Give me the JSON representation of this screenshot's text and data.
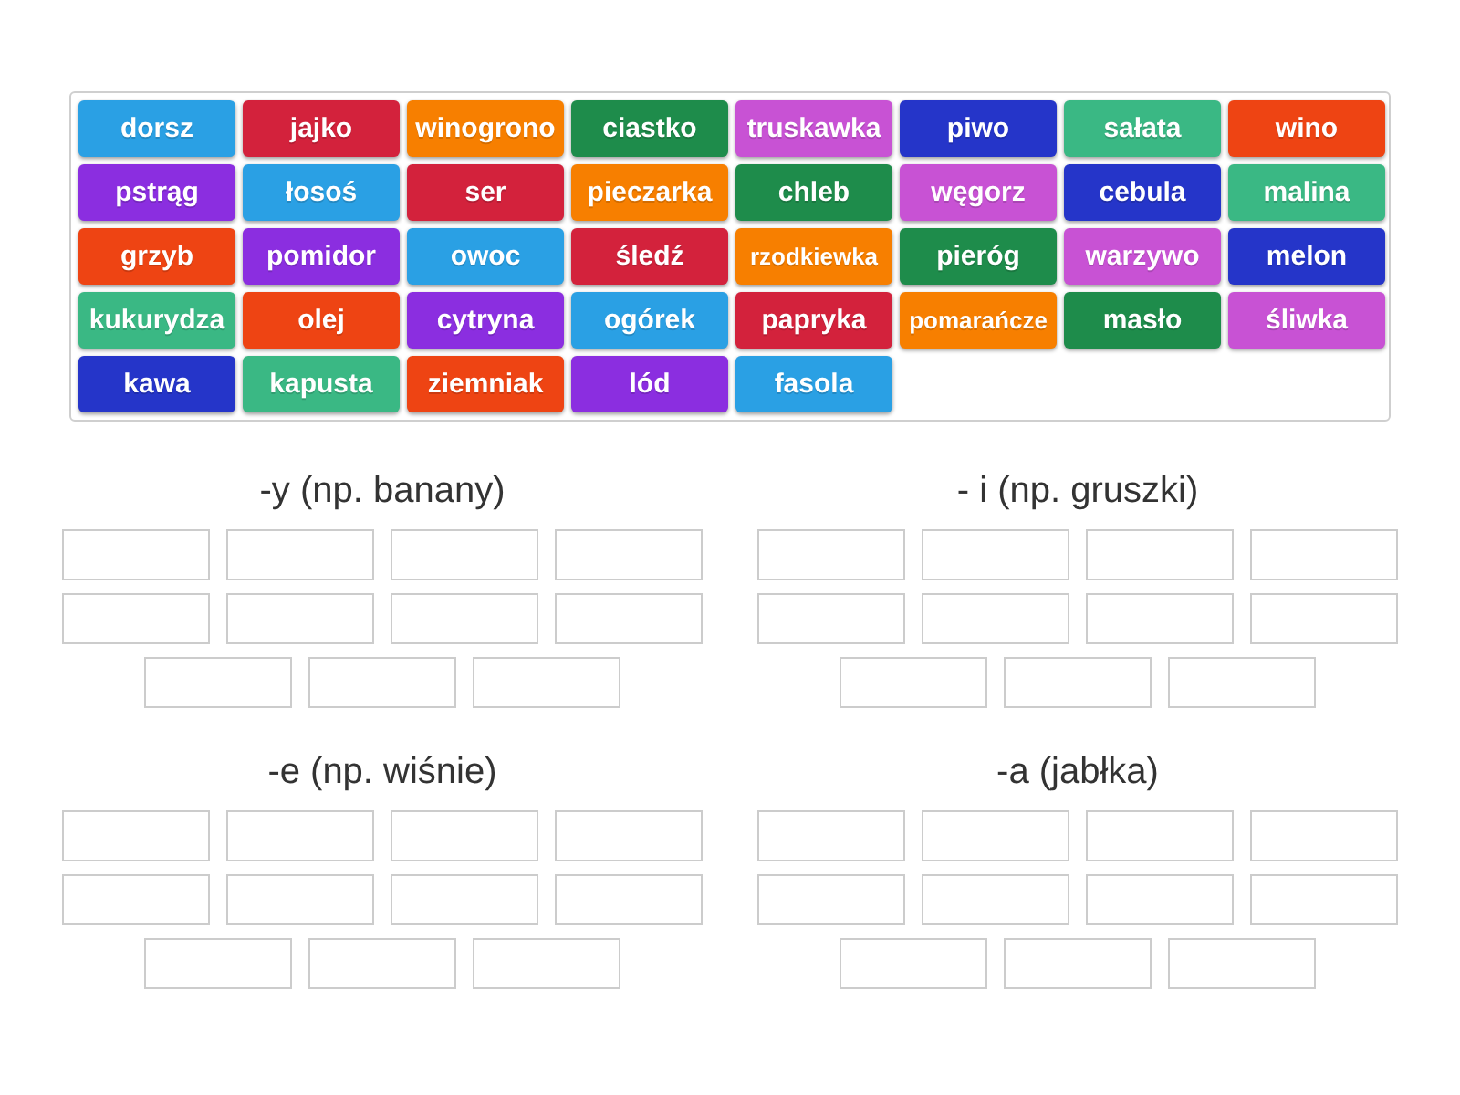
{
  "tiles": [
    {
      "label": "dorsz",
      "color": "#2aa0e4"
    },
    {
      "label": "jajko",
      "color": "#d3223c"
    },
    {
      "label": "winogrono",
      "color": "#f77f00"
    },
    {
      "label": "ciastko",
      "color": "#1e8c4b"
    },
    {
      "label": "truskawka",
      "color": "#c852d4"
    },
    {
      "label": "piwo",
      "color": "#2535c9"
    },
    {
      "label": "sałata",
      "color": "#3ab884"
    },
    {
      "label": "wino",
      "color": "#ee4413"
    },
    {
      "label": "pstrąg",
      "color": "#8b2ee0"
    },
    {
      "label": "łosoś",
      "color": "#2aa0e4"
    },
    {
      "label": "ser",
      "color": "#d3223c"
    },
    {
      "label": "pieczarka",
      "color": "#f77f00"
    },
    {
      "label": "chleb",
      "color": "#1e8c4b"
    },
    {
      "label": "węgorz",
      "color": "#c852d4"
    },
    {
      "label": "cebula",
      "color": "#2535c9"
    },
    {
      "label": "malina",
      "color": "#3ab884"
    },
    {
      "label": "grzyb",
      "color": "#ee4413"
    },
    {
      "label": "pomidor",
      "color": "#8b2ee0"
    },
    {
      "label": "owoc",
      "color": "#2aa0e4"
    },
    {
      "label": "śledź",
      "color": "#d3223c"
    },
    {
      "label": "rzodkiewka",
      "color": "#f77f00"
    },
    {
      "label": "pieróg",
      "color": "#1e8c4b"
    },
    {
      "label": "warzywo",
      "color": "#c852d4"
    },
    {
      "label": "melon",
      "color": "#2535c9"
    },
    {
      "label": "kukurydza",
      "color": "#3ab884"
    },
    {
      "label": "olej",
      "color": "#ee4413"
    },
    {
      "label": "cytryna",
      "color": "#8b2ee0"
    },
    {
      "label": "ogórek",
      "color": "#2aa0e4"
    },
    {
      "label": "papryka",
      "color": "#d3223c"
    },
    {
      "label": "pomarańcze",
      "color": "#f77f00"
    },
    {
      "label": "masło",
      "color": "#1e8c4b"
    },
    {
      "label": "śliwka",
      "color": "#c852d4"
    },
    {
      "label": "kawa",
      "color": "#2535c9"
    },
    {
      "label": "kapusta",
      "color": "#3ab884"
    },
    {
      "label": "ziemniak",
      "color": "#ee4413"
    },
    {
      "label": "lód",
      "color": "#8b2ee0"
    },
    {
      "label": "fasola",
      "color": "#2aa0e4"
    }
  ],
  "groups": [
    {
      "title": "-y (np. banany)",
      "slots": [
        {
          "kind": "empty"
        },
        {
          "kind": "empty"
        },
        {
          "kind": "empty"
        },
        {
          "kind": "empty"
        },
        {
          "kind": "empty"
        },
        {
          "kind": "empty"
        },
        {
          "kind": "empty"
        },
        {
          "kind": "empty"
        },
        {
          "kind": "empty"
        },
        {
          "kind": "empty"
        },
        {
          "kind": "empty"
        }
      ]
    },
    {
      "title": "- i (np. gruszki)",
      "slots": [
        {
          "kind": "empty"
        },
        {
          "kind": "empty"
        },
        {
          "kind": "empty"
        },
        {
          "kind": "empty"
        },
        {
          "kind": "empty"
        },
        {
          "kind": "empty"
        },
        {
          "kind": "empty"
        },
        {
          "kind": "empty"
        },
        {
          "kind": "empty"
        },
        {
          "kind": "empty"
        },
        {
          "kind": "empty"
        }
      ]
    },
    {
      "title": "-e (np. wiśnie)",
      "slots": [
        {
          "kind": "empty"
        },
        {
          "kind": "empty"
        },
        {
          "kind": "empty"
        },
        {
          "kind": "empty"
        },
        {
          "kind": "empty"
        },
        {
          "kind": "empty"
        },
        {
          "kind": "empty"
        },
        {
          "kind": "empty"
        },
        {
          "kind": "empty"
        },
        {
          "kind": "empty"
        },
        {
          "kind": "empty"
        }
      ]
    },
    {
      "title": "-a (jabłka)",
      "slots": [
        {
          "kind": "empty"
        },
        {
          "kind": "empty"
        },
        {
          "kind": "empty"
        },
        {
          "kind": "empty"
        },
        {
          "kind": "empty"
        },
        {
          "kind": "empty"
        },
        {
          "kind": "empty"
        },
        {
          "kind": "empty"
        },
        {
          "kind": "empty"
        },
        {
          "kind": "empty"
        },
        {
          "kind": "empty"
        }
      ]
    }
  ]
}
